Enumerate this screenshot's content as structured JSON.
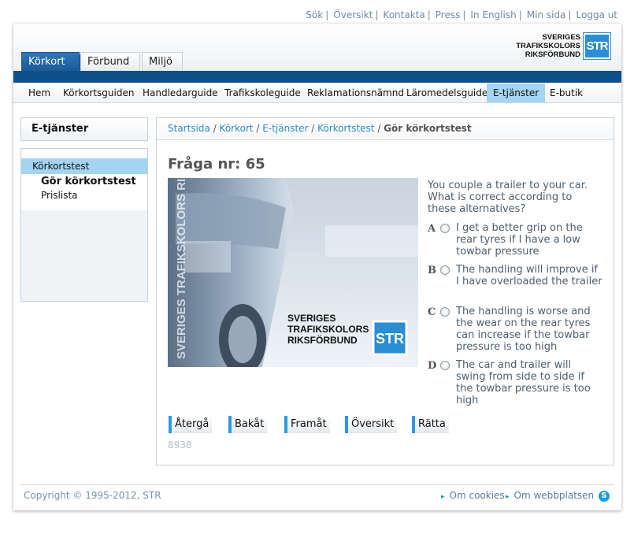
{
  "toplinks": [
    "Sök",
    "Översikt",
    "Kontakta",
    "Press",
    "In English",
    "Min sida",
    "Logga ut"
  ],
  "tabs": [
    "Körkort",
    "Förbund",
    "Miljö"
  ],
  "logo": {
    "line1": "SVERIGES",
    "line2": "TRAFIKSKOLORS",
    "line3": "RIKSFÖRBUND",
    "mark": "STR"
  },
  "nav": [
    "Hem",
    "Körkortsguiden",
    "Handledarguide",
    "Trafikskoleguide",
    "Reklamationsnämnd",
    "Läromedelsguide",
    "E-tjänster",
    "E-butik"
  ],
  "sidebar": {
    "title": "E-tjänster",
    "item": "Körkortstest",
    "sub_active": "Gör körkortstest",
    "sub": "Prislista"
  },
  "breadcrumb": [
    "Startsida",
    "Körkort",
    "E-tjänster",
    "Körkortstest"
  ],
  "breadcrumb_current": "Gör körkortstest",
  "question": {
    "title": "Fråga nr: 65",
    "text": "You couple a trailer to your car. What is correct according to these alternatives?",
    "options": [
      {
        "letter": "A",
        "text": "I get a better grip on the rear tyres if I have a low towbar pressure"
      },
      {
        "letter": "B",
        "text": "The handling will improve if I have overloaded the trailer"
      },
      {
        "letter": "C",
        "text": "The handling is worse and the wear on the rear tyres can increase if the towbar pressure is too high"
      },
      {
        "letter": "D",
        "text": "The car and trailer will swing from side to side if the towbar pressure is too high"
      }
    ]
  },
  "image": {
    "watermark": "SVERIGES TRAFIKSKOLORS RIKSFÖRBUND"
  },
  "buttons": [
    "Återgå",
    "Bakåt",
    "Framåt",
    "Översikt",
    "Rätta"
  ],
  "code": "8938",
  "footer": {
    "copyright": "Copyright © 1995-2012, STR",
    "links": [
      "Om cookies",
      "Om webbplatsen"
    ]
  },
  "colors": {
    "brand_blue": "#0f4f8c",
    "accent": "#2a8ed6",
    "highlight": "#a3d5f2"
  }
}
